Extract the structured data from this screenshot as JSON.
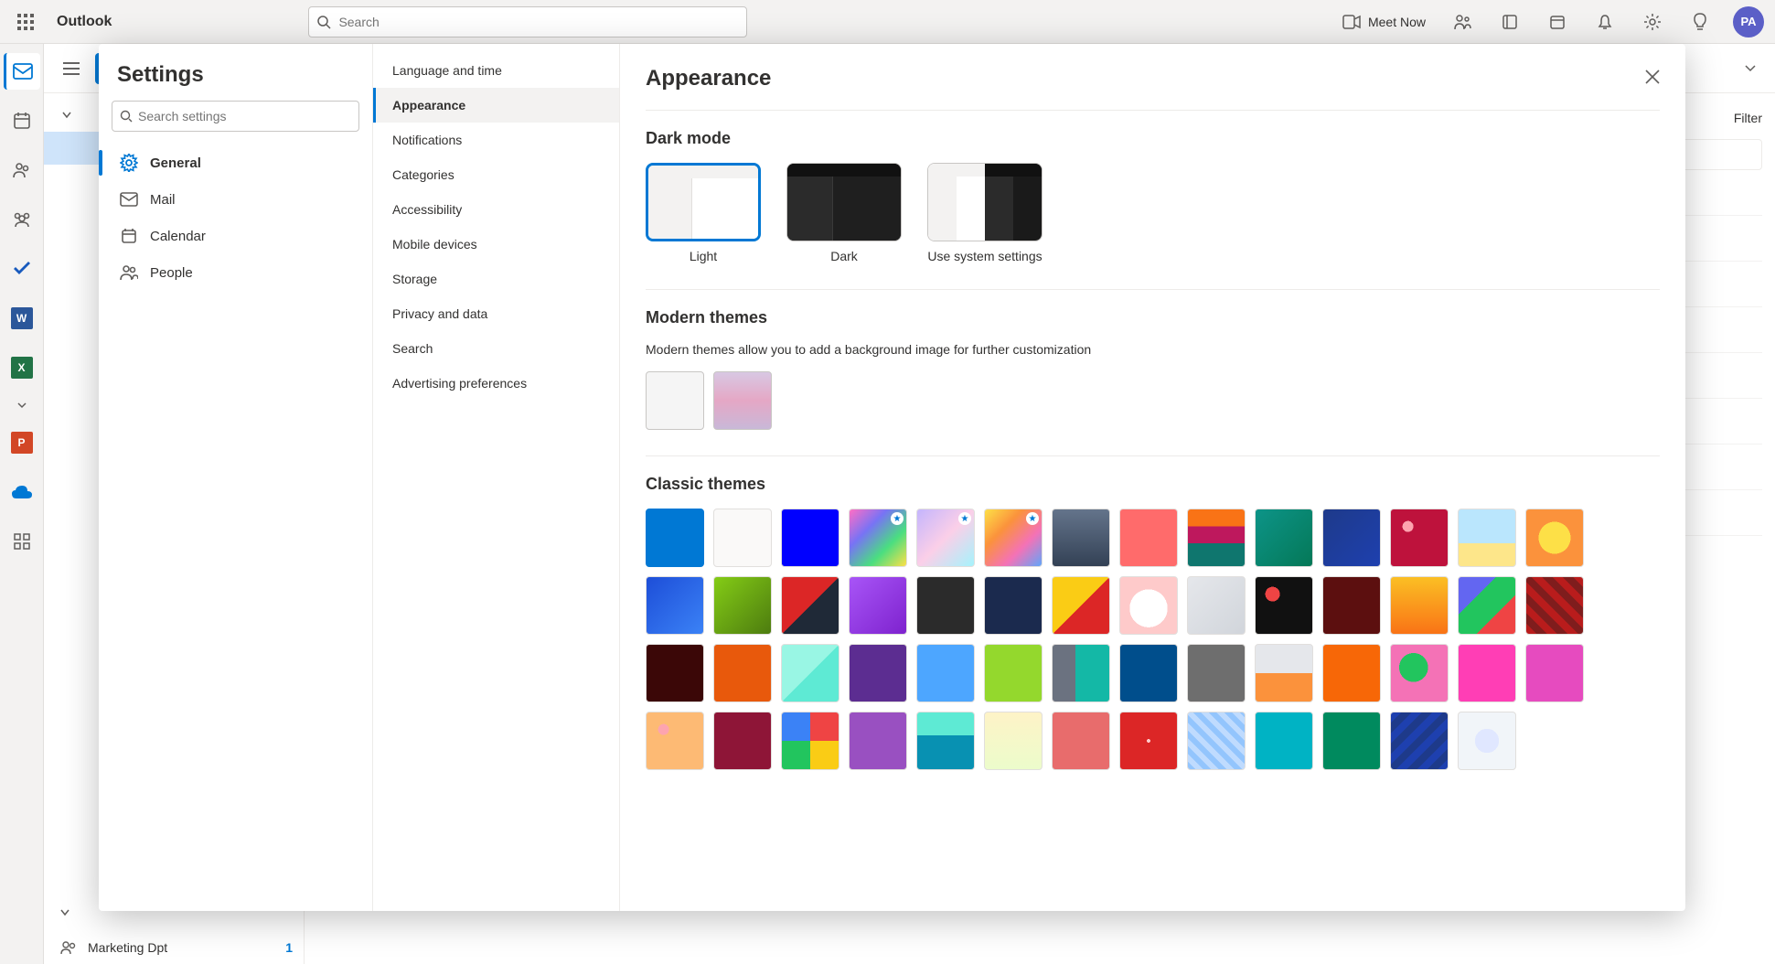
{
  "header": {
    "app_name": "Outlook",
    "search_placeholder": "Search",
    "meet_now": "Meet Now",
    "avatar_initials": "PA"
  },
  "toolbar": {
    "filter_label": "Filter"
  },
  "groups": {
    "label": "Marketing Dpt",
    "count": "1"
  },
  "settings": {
    "title": "Settings",
    "search_placeholder": "Search settings",
    "nav": {
      "general": "General",
      "mail": "Mail",
      "calendar": "Calendar",
      "people": "People"
    },
    "sub": {
      "language_time": "Language and time",
      "appearance": "Appearance",
      "notifications": "Notifications",
      "categories": "Categories",
      "accessibility": "Accessibility",
      "mobile_devices": "Mobile devices",
      "storage": "Storage",
      "privacy_data": "Privacy and data",
      "search": "Search",
      "advertising": "Advertising preferences"
    }
  },
  "appearance": {
    "title": "Appearance",
    "dark_mode": {
      "title": "Dark mode",
      "light": "Light",
      "dark": "Dark",
      "system": "Use system settings"
    },
    "modern_themes": {
      "title": "Modern themes",
      "desc": "Modern themes allow you to add a background image for further customization"
    },
    "classic_themes": {
      "title": "Classic themes",
      "themes": [
        {
          "c1": "#0078d4",
          "c2": "#0078d4",
          "selected": true
        },
        {
          "c1": "#faf9f8",
          "c2": "#f3f2f1"
        },
        {
          "c1": "#0000ff",
          "c2": "#0000ff"
        },
        {
          "grad": "rainbow",
          "premium": true
        },
        {
          "grad": "pastel",
          "premium": true
        },
        {
          "grad": "rainbow2",
          "premium": true
        },
        {
          "grad": "mountain"
        },
        {
          "c1": "#ff6b6b",
          "c2": "#e03131"
        },
        {
          "grad": "sunset"
        },
        {
          "grad": "circuit"
        },
        {
          "grad": "navytri"
        },
        {
          "grad": "reddots"
        },
        {
          "grad": "beach"
        },
        {
          "grad": "star"
        },
        {
          "grad": "bluewave"
        },
        {
          "grad": "greenhex"
        },
        {
          "grad": "redshapes"
        },
        {
          "grad": "purplediag"
        },
        {
          "c1": "#2b2b2b",
          "c2": "#2b2b2b"
        },
        {
          "c1": "#1b2a4e",
          "c2": "#1b2a4e"
        },
        {
          "grad": "lego"
        },
        {
          "grad": "cat"
        },
        {
          "grad": "diamond"
        },
        {
          "grad": "bokeh"
        },
        {
          "c1": "#5c0f0f",
          "c2": "#5c0f0f"
        },
        {
          "grad": "orangecone"
        },
        {
          "grad": "bluegreen"
        },
        {
          "grad": "redstripe"
        },
        {
          "c1": "#3b0707",
          "c2": "#3b0707"
        },
        {
          "c1": "#e8590c",
          "c2": "#e8590c"
        },
        {
          "grad": "tealtri"
        },
        {
          "c1": "#5c2d91",
          "c2": "#5c2d91"
        },
        {
          "c1": "#4da6ff",
          "c2": "#4da6ff"
        },
        {
          "c1": "#94d82d",
          "c2": "#94d82d"
        },
        {
          "grad": "greensplit"
        },
        {
          "c1": "#004e8c",
          "c2": "#004e8c"
        },
        {
          "c1": "#6e6e6e",
          "c2": "#6e6e6e"
        },
        {
          "grad": "tanorange"
        },
        {
          "c1": "#f76707",
          "c2": "#f76707"
        },
        {
          "grad": "paintsplat"
        },
        {
          "c1": "#ff3eb5",
          "c2": "#ff3eb5"
        },
        {
          "c1": "#e64bbf",
          "c2": "#e64bbf"
        },
        {
          "grad": "peachdots"
        },
        {
          "c1": "#8e1537",
          "c2": "#8e1537"
        },
        {
          "grad": "googlecolors"
        },
        {
          "c1": "#9950c1",
          "c2": "#9950c1"
        },
        {
          "grad": "robot"
        },
        {
          "grad": "cream"
        },
        {
          "c1": "#e86c6c",
          "c2": "#e86c6c"
        },
        {
          "grad": "strawberry"
        },
        {
          "grad": "pixelblue"
        },
        {
          "c1": "#00b3c4",
          "c2": "#00b3c4"
        },
        {
          "c1": "#008a5e",
          "c2": "#008a5e"
        },
        {
          "grad": "bluechev"
        },
        {
          "grad": "snowflake"
        }
      ]
    }
  }
}
